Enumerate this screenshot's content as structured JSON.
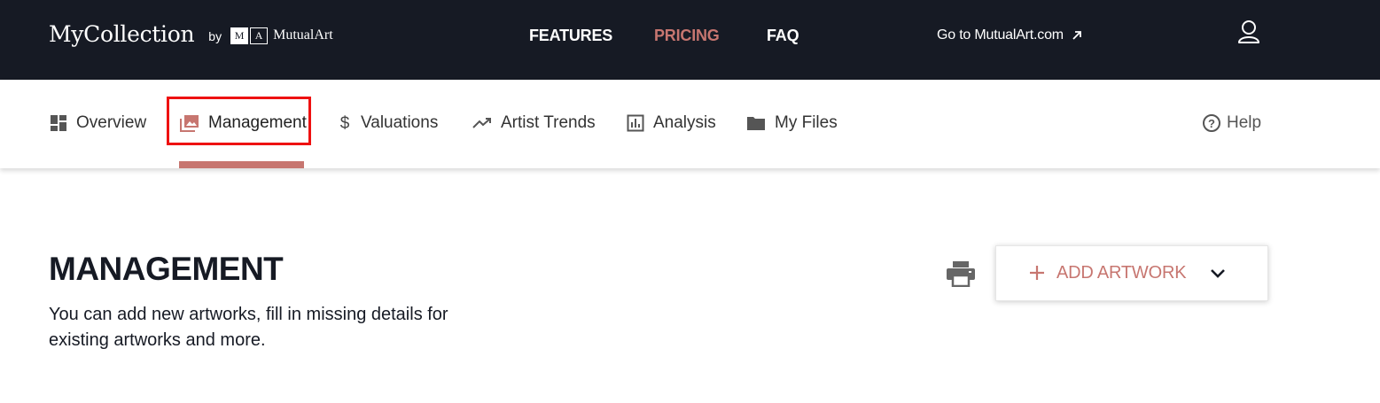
{
  "header": {
    "brand_name": "MyCollection",
    "brand_by": "by",
    "logo_m": "M",
    "logo_a": "A",
    "logo_text": "MutualArt",
    "nav": {
      "features": "FEATURES",
      "pricing": "PRICING",
      "faq": "FAQ"
    },
    "goto_link": "Go to MutualArt.com",
    "colors": {
      "background": "#161a24",
      "accent": "#c77670"
    }
  },
  "subnav": {
    "tabs": [
      {
        "label": "Overview",
        "icon": "dashboard-icon"
      },
      {
        "label": "Management",
        "icon": "image-gallery-icon",
        "active": true
      },
      {
        "label": "Valuations",
        "icon": "dollar-icon"
      },
      {
        "label": "Artist Trends",
        "icon": "trending-up-icon"
      },
      {
        "label": "Analysis",
        "icon": "bar-chart-icon"
      },
      {
        "label": "My Files",
        "icon": "folder-icon"
      }
    ],
    "help": {
      "label": "Help",
      "icon": "help-circle-icon"
    }
  },
  "main": {
    "title": "MANAGEMENT",
    "description": "You can add new artworks, fill in missing details for existing artworks and more.",
    "add_button": {
      "label": "ADD ARTWORK",
      "icon": "plus-icon",
      "dropdown_icon": "chevron-down-icon"
    },
    "print_icon": "printer-icon"
  }
}
